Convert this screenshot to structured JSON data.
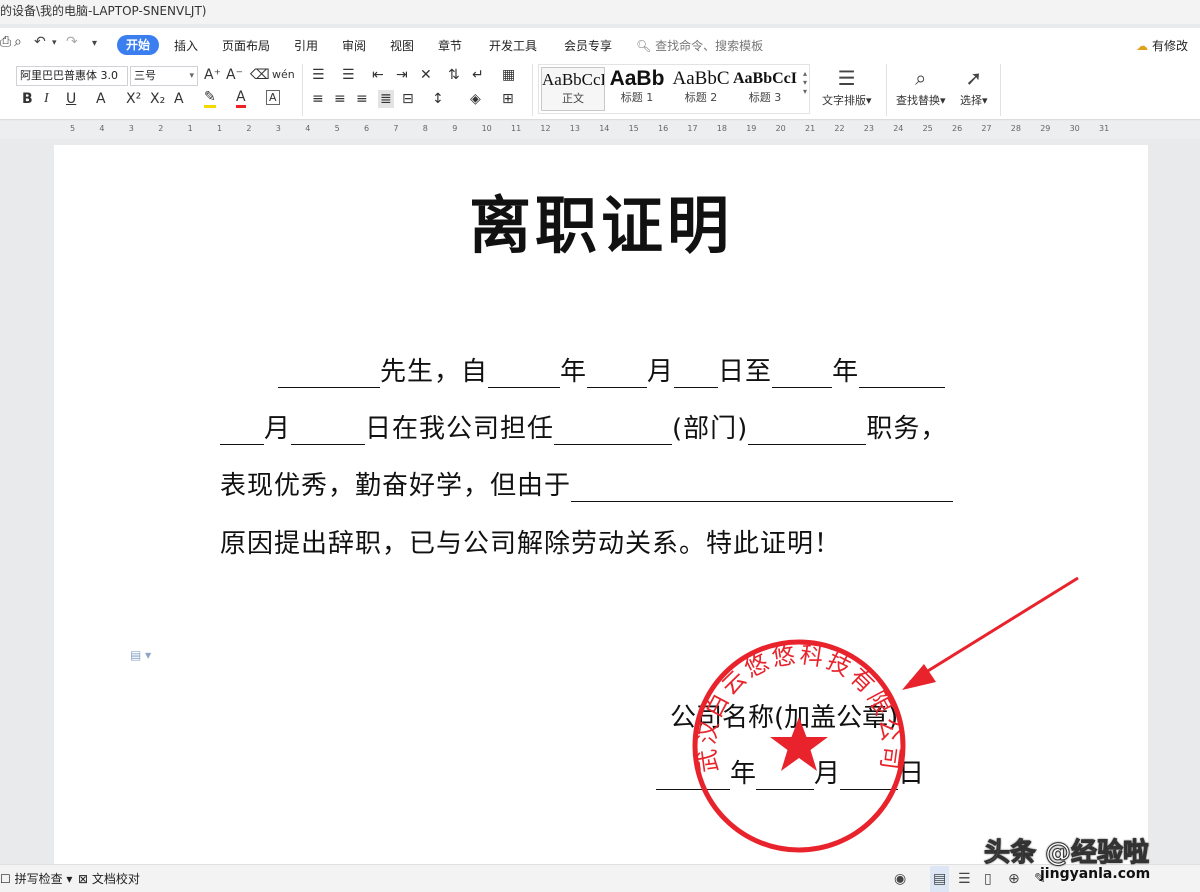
{
  "window": {
    "title": "的设备\\我的电脑-LAPTOP-SNENVLJT)"
  },
  "menu": {
    "tabs": [
      "开始",
      "插入",
      "页面布局",
      "引用",
      "审阅",
      "视图",
      "章节",
      "开发工具",
      "会员专享"
    ],
    "search_placeholder": "查找命令、搜索模板",
    "edit_status": "有修改"
  },
  "ribbon": {
    "font_name": "阿里巴巴普惠体 3.0",
    "font_size": "三号",
    "styles": [
      {
        "preview": "AaBbCcDd",
        "name": "正文"
      },
      {
        "preview": "AaBb",
        "name": "标题 1"
      },
      {
        "preview": "AaBbC",
        "name": "标题 2"
      },
      {
        "preview": "AaBbCcI",
        "name": "标题 3"
      }
    ],
    "text_layout": "文字排版",
    "find_replace": "查找替换",
    "select": "选择"
  },
  "ruler": {
    "numbers": [
      "5",
      "4",
      "3",
      "2",
      "1",
      "1",
      "2",
      "3",
      "4",
      "5",
      "6",
      "7",
      "8",
      "9",
      "10",
      "11",
      "12",
      "13",
      "14",
      "15",
      "16",
      "17",
      "18",
      "19",
      "20",
      "21",
      "22",
      "23",
      "24",
      "25",
      "26",
      "27",
      "28",
      "29",
      "30",
      "31"
    ]
  },
  "document": {
    "title": "离职证明",
    "line1": {
      "a": "先生，自",
      "b": "年",
      "c": "月",
      "d": "日至",
      "e": "年"
    },
    "line2": {
      "a": "月",
      "b": "日在我公司担任",
      "c": "(部门)",
      "d": "职务，"
    },
    "line3": "表现优秀，勤奋好学，但由于",
    "line4": "原因提出辞职，已与公司解除劳动关系。特此证明！",
    "company": "公司名称(加盖公章)",
    "date": {
      "y": "年",
      "m": "月",
      "d": "日"
    }
  },
  "seal": {
    "text": "武汉白云悠悠科技有限公司",
    "color": "#e8232b"
  },
  "statusbar": {
    "spell": "拼写检查",
    "proof": "文档校对"
  },
  "watermark": {
    "line1": "头条 @经验啦",
    "line2": "jingyanla.com"
  }
}
